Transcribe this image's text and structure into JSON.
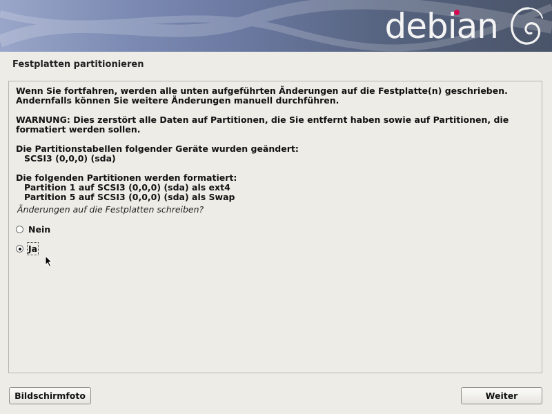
{
  "header": {
    "logo_text": "debian",
    "swirl_icon": "debian-swirl-icon",
    "colors": {
      "banner_start": "#9aa6c9",
      "banner_end": "#4a5469",
      "logo_dot": "#d70751"
    }
  },
  "page_title": "Festplatten partitionieren",
  "content": {
    "intro_line1": "Wenn Sie fortfahren, werden alle unten aufgeführten Änderungen auf die Festplatte(n) geschrieben.",
    "intro_line2": "Andernfalls können Sie weitere Änderungen manuell durchführen.",
    "warning_line1": "WARNUNG: Dies zerstört alle Daten auf Partitionen, die Sie entfernt haben sowie auf Partitionen, die",
    "warning_line2": "formatiert werden sollen.",
    "tables_header": "Die Partitionstabellen folgender Geräte wurden geändert:",
    "tables_items": [
      "SCSI3 (0,0,0) (sda)"
    ],
    "format_header": "Die folgenden Partitionen werden formatiert:",
    "format_items": [
      "Partition 1 auf SCSI3 (0,0,0) (sda) als ext4",
      "Partition 5 auf SCSI3 (0,0,0) (sda) als Swap"
    ],
    "question": "Änderungen auf die Festplatten schreiben?"
  },
  "options": [
    {
      "label": "Nein",
      "selected": false
    },
    {
      "label": "Ja",
      "selected": true
    }
  ],
  "buttons": {
    "screenshot": "Bildschirmfoto",
    "next": "Weiter"
  }
}
